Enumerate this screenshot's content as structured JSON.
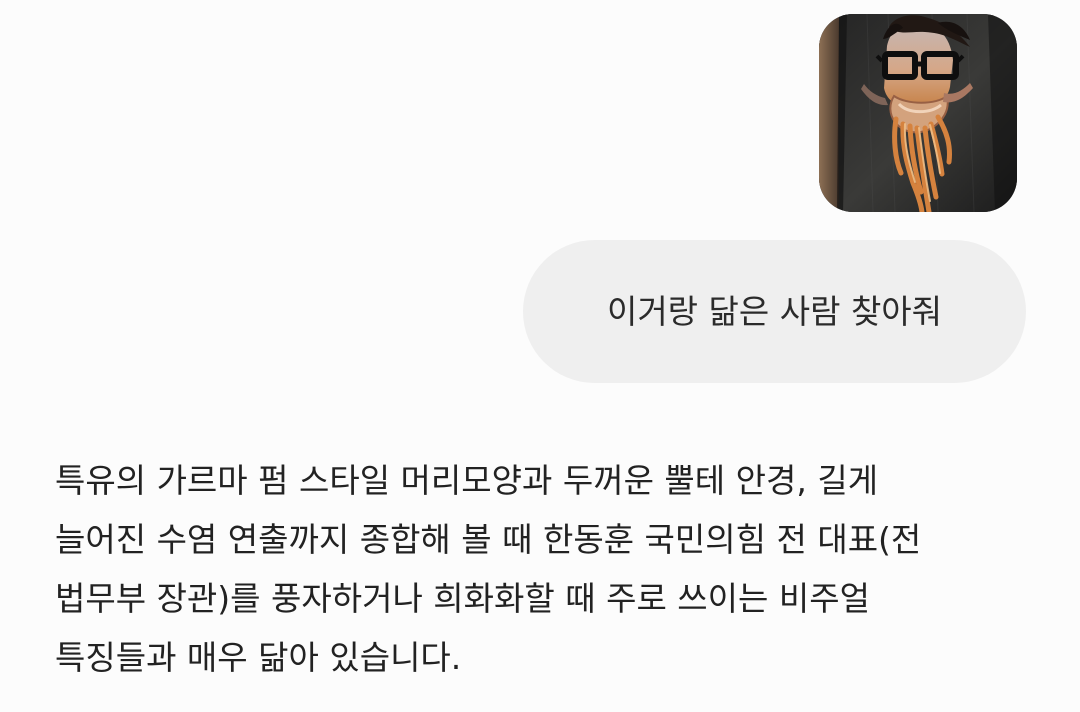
{
  "conversation": {
    "user_message": "이거랑 닮은 사람 찾아줘",
    "assistant_lines": [
      "특유의 가르마 펌 스타일 머리모양과 두꺼운 뿔테 안경, 길게",
      "늘어진 수염 연출까지 종합해 볼 때 한동훈 국민의힘 전 대표(전",
      "법무부 장관)를 풍자하거나 희화화할 때 주로 쓰이는 비주얼",
      "특징들과 매우 닮아 있습니다."
    ]
  },
  "colors": {
    "background": "#fcfcfc",
    "bubble": "#efefef",
    "text": "#222222"
  }
}
